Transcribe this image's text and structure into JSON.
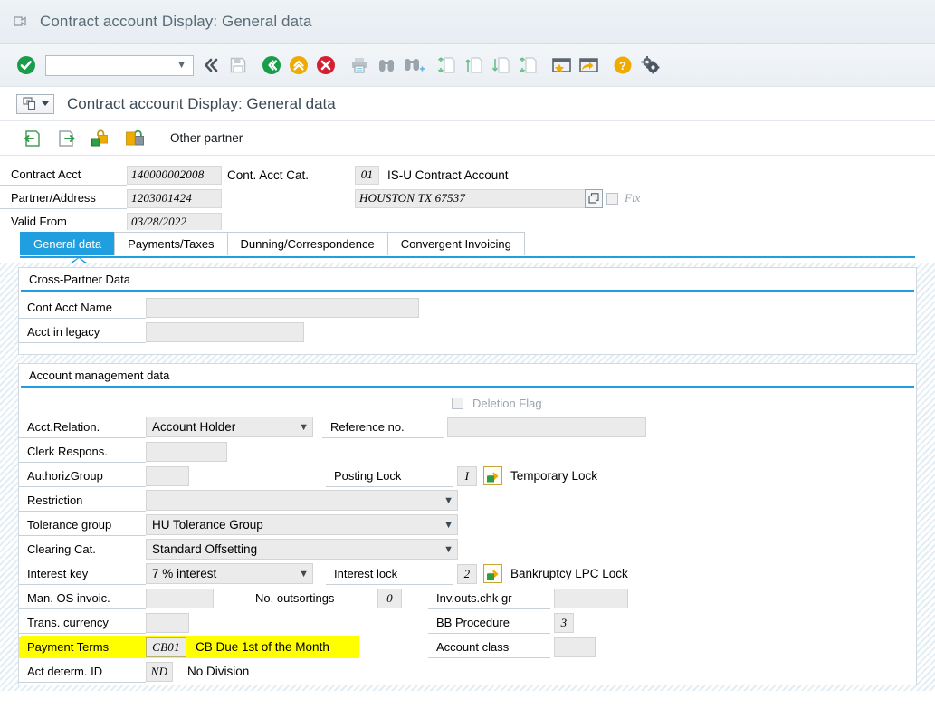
{
  "window": {
    "title": "Contract account Display: General data",
    "title_icon": "pointing-hand-icon"
  },
  "toolbar": {
    "ok_icon": "green-check-icon",
    "command_field_value": "",
    "command_field_placeholder": "",
    "items": [
      {
        "name": "enter-button",
        "label": "Enter",
        "icon": "green-check-icon"
      },
      {
        "name": "back-navigation-button",
        "label": "Back",
        "icon": "double-chevron-left-icon"
      },
      {
        "name": "save-button",
        "label": "Save",
        "icon": "save-disk-icon"
      },
      {
        "name": "back-button",
        "label": "Back",
        "icon": "green-back-icon"
      },
      {
        "name": "exit-button",
        "label": "Exit",
        "icon": "yellow-up-icon"
      },
      {
        "name": "cancel-button",
        "label": "Cancel",
        "icon": "red-cancel-icon"
      },
      {
        "name": "print-button",
        "label": "Print",
        "icon": "printer-icon"
      },
      {
        "name": "find-button",
        "label": "Find",
        "icon": "binoculars-icon"
      },
      {
        "name": "find-next-button",
        "label": "Find Next",
        "icon": "binoculars-plus-icon"
      },
      {
        "name": "first-page-button",
        "label": "First Page",
        "icon": "first-page-icon"
      },
      {
        "name": "previous-page-button",
        "label": "Previous Page",
        "icon": "previous-page-icon"
      },
      {
        "name": "next-page-button",
        "label": "Next Page",
        "icon": "next-page-icon"
      },
      {
        "name": "last-page-button",
        "label": "Last Page",
        "icon": "last-page-icon"
      },
      {
        "name": "create-session-button",
        "label": "Create Session",
        "icon": "new-window-star-icon"
      },
      {
        "name": "create-shortcut-button",
        "label": "Create Shortcut",
        "icon": "new-window-arrow-icon"
      },
      {
        "name": "help-button",
        "label": "Help",
        "icon": "help-question-icon"
      },
      {
        "name": "customize-button",
        "label": "Customize Local Layout",
        "icon": "gear-icon"
      }
    ]
  },
  "subtitle": {
    "text": "Contract account Display: General data",
    "sys_icon": "system-menu-icon"
  },
  "apptoolbar": {
    "buttons": [
      {
        "name": "previous-partner-button",
        "icon": "green-left-arrow-doc-icon"
      },
      {
        "name": "next-partner-button",
        "icon": "green-right-arrow-doc-icon"
      },
      {
        "name": "unlock-button",
        "icon": "open-lock-icon"
      },
      {
        "name": "lock-button",
        "icon": "closed-lock-icon"
      }
    ],
    "other_partner_label": "Other partner"
  },
  "header": {
    "contract_acct_label": "Contract Acct",
    "contract_acct_value": "140000002008",
    "cont_acct_cat_label": "Cont. Acct Cat.",
    "cont_acct_cat_value": "01",
    "cont_acct_cat_text": "IS-U Contract Account",
    "partner_address_label": "Partner/Address",
    "partner_address_value": "1203001424",
    "address_value": "HOUSTON TX 67537",
    "address_picker_icon": "overlapping-squares-icon",
    "fix_label": "Fix",
    "fix_checked": false,
    "valid_from_label": "Valid From",
    "valid_from_value": "03/28/2022"
  },
  "tabs": [
    {
      "name": "tab-general-data",
      "label": "General data",
      "active": true
    },
    {
      "name": "tab-payments-taxes",
      "label": "Payments/Taxes",
      "active": false
    },
    {
      "name": "tab-dunning-correspondence",
      "label": "Dunning/Correspondence",
      "active": false
    },
    {
      "name": "tab-convergent-invoicing",
      "label": "Convergent Invoicing",
      "active": false
    }
  ],
  "cross_partner": {
    "title": "Cross-Partner Data",
    "cont_acct_name_label": "Cont Acct Name",
    "cont_acct_name_value": "",
    "acct_in_legacy_label": "Acct in legacy",
    "acct_in_legacy_value": ""
  },
  "account_mgmt": {
    "title": "Account management data",
    "deletion_flag_label": "Deletion Flag",
    "deletion_flag_checked": false,
    "acct_relation_label": "Acct.Relation.",
    "acct_relation_value": "Account Holder",
    "reference_no_label": "Reference no.",
    "reference_no_value": "",
    "clerk_respons_label": "Clerk Respons.",
    "clerk_respons_value": "",
    "authoriz_group_label": "AuthorizGroup",
    "authoriz_group_value": "",
    "posting_lock_label": "Posting Lock",
    "posting_lock_value": "I",
    "temporary_lock_label": "Temporary Lock",
    "temporary_lock_icon": "green-lock-arrow-icon",
    "restriction_label": "Restriction",
    "restriction_value": "",
    "tolerance_group_label": "Tolerance group",
    "tolerance_group_value": "HU Tolerance Group",
    "clearing_cat_label": "Clearing Cat.",
    "clearing_cat_value": "Standard Offsetting",
    "interest_key_label": "Interest key",
    "interest_key_value": "7 % interest",
    "interest_lock_label": "Interest lock",
    "interest_lock_value": "2",
    "bankruptcy_lpc_lock_label": "Bankruptcy LPC Lock",
    "bankruptcy_lpc_lock_icon": "green-lock-arrow-icon",
    "man_os_invoic_label": "Man. OS invoic.",
    "man_os_invoic_value": "",
    "no_outsortings_label": "No. outsortings",
    "no_outsortings_value": "0",
    "inv_outs_chk_gr_label": "Inv.outs.chk gr",
    "inv_outs_chk_gr_value": "",
    "trans_currency_label": "Trans. currency",
    "trans_currency_value": "",
    "bb_procedure_label": "BB Procedure",
    "bb_procedure_value": "3",
    "payment_terms_label": "Payment Terms",
    "payment_terms_value": "CB01",
    "payment_terms_text": "CB Due 1st of the Month",
    "payment_terms_highlighted": true,
    "account_class_label": "Account class",
    "account_class_value": "",
    "act_determ_id_label": "Act determ. ID",
    "act_determ_id_value": "ND",
    "act_determ_id_text": "No Division"
  },
  "colors": {
    "accent": "#1f9fe0",
    "highlight": "#ffff00",
    "field_bg": "#ebebeb",
    "title_text": "#5a6b78"
  }
}
